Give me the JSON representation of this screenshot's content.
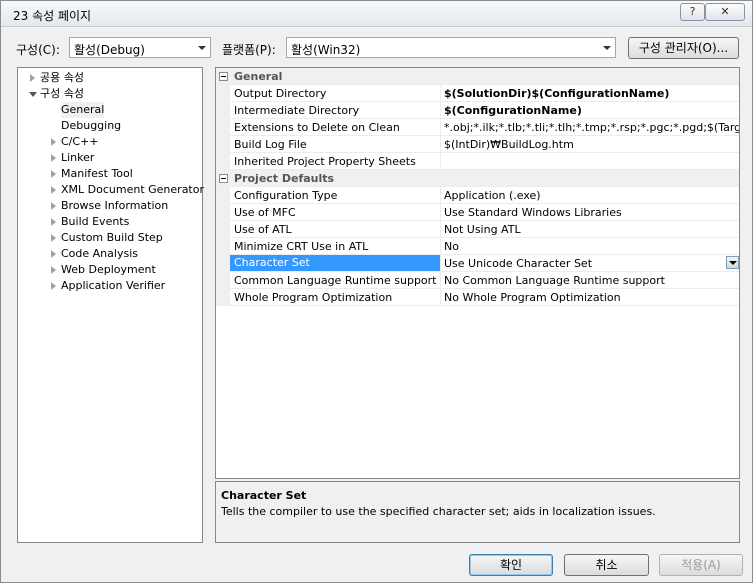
{
  "window": {
    "title": "23 속성 페이지",
    "help_label": "?",
    "close_label": "✕"
  },
  "config": {
    "label": "구성(C):",
    "value": "활성(Debug)"
  },
  "platform": {
    "label": "플랫폼(P):",
    "value": "활성(Win32)"
  },
  "config_manager_label": "구성 관리자(O)...",
  "tree": {
    "items": [
      {
        "label": "공용 속성",
        "expanded": false
      },
      {
        "label": "구성 속성",
        "expanded": true
      },
      {
        "label": "General",
        "selected": true
      },
      {
        "label": "Debugging"
      },
      {
        "label": "C/C++"
      },
      {
        "label": "Linker"
      },
      {
        "label": "Manifest Tool"
      },
      {
        "label": "XML Document Generator"
      },
      {
        "label": "Browse Information"
      },
      {
        "label": "Build Events"
      },
      {
        "label": "Custom Build Step"
      },
      {
        "label": "Code Analysis"
      },
      {
        "label": "Web Deployment"
      },
      {
        "label": "Application Verifier"
      }
    ]
  },
  "grid": {
    "general": {
      "title": "General",
      "rows": [
        {
          "name": "Output Directory",
          "value": "$(SolutionDir)$(ConfigurationName)"
        },
        {
          "name": "Intermediate Directory",
          "value": "$(ConfigurationName)"
        },
        {
          "name": "Extensions to Delete on Clean",
          "value": "*.obj;*.ilk;*.tlb;*.tli;*.tlh;*.tmp;*.rsp;*.pgc;*.pgd;$(TargetPath)"
        },
        {
          "name": "Build Log File",
          "value": "$(IntDir)₩BuildLog.htm"
        },
        {
          "name": "Inherited Project Property Sheets",
          "value": ""
        }
      ]
    },
    "defaults": {
      "title": "Project Defaults",
      "rows": [
        {
          "name": "Configuration Type",
          "value": "Application (.exe)"
        },
        {
          "name": "Use of MFC",
          "value": "Use Standard Windows Libraries"
        },
        {
          "name": "Use of ATL",
          "value": "Not Using ATL"
        },
        {
          "name": "Minimize CRT Use in ATL",
          "value": "No"
        },
        {
          "name": "Character Set",
          "value": "Use Unicode Character Set"
        },
        {
          "name": "Common Language Runtime support",
          "value": "No Common Language Runtime support"
        },
        {
          "name": "Whole Program Optimization",
          "value": "No Whole Program Optimization"
        }
      ]
    }
  },
  "description": {
    "title": "Character Set",
    "text": "Tells the compiler to use the specified character set; aids in localization issues."
  },
  "buttons": {
    "ok": "확인",
    "cancel": "취소",
    "apply": "적용(A)"
  },
  "colors": {
    "selection": "#3399ff"
  }
}
